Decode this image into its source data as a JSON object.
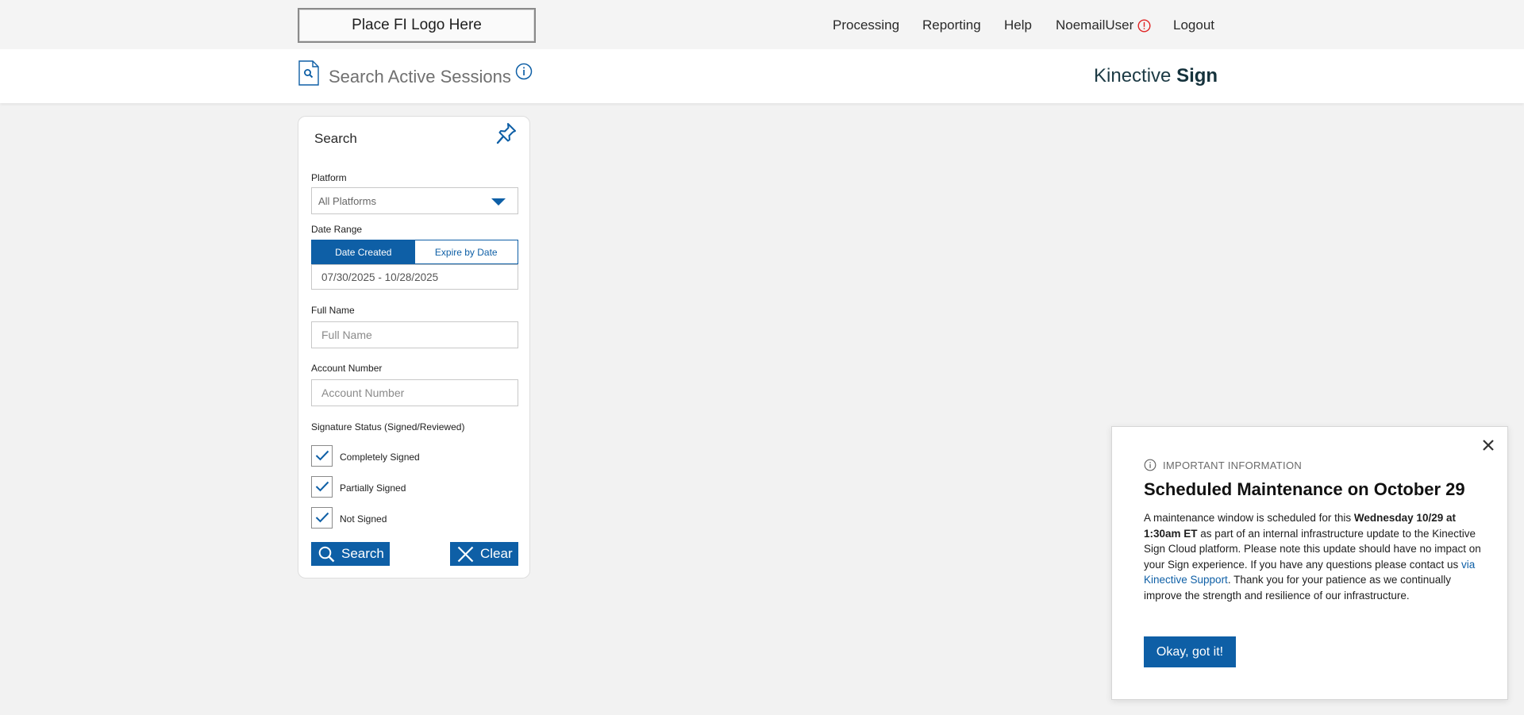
{
  "header": {
    "logo_text": "Place FI Logo Here",
    "nav": {
      "processing": "Processing",
      "reporting": "Reporting",
      "help": "Help",
      "user": "NoemailUser",
      "logout": "Logout"
    },
    "alert_icon": "alert-circle-icon",
    "alert_color": "#e02424"
  },
  "page": {
    "icon": "document-search-icon",
    "title": "Search Active Sessions",
    "info_icon": "info-circle-icon",
    "brand_light": "Kinective",
    "brand_bold": "Sign"
  },
  "search_panel": {
    "title": "Search",
    "pin_icon": "pin-icon",
    "platform": {
      "label": "Platform",
      "value": "All Platforms"
    },
    "date_range": {
      "label": "Date Range",
      "toggle_active": "Date Created",
      "toggle_inactive": "Expire by Date",
      "value": "07/30/2025 - 10/28/2025"
    },
    "full_name": {
      "label": "Full Name",
      "placeholder": "Full Name"
    },
    "account_number": {
      "label": "Account Number",
      "placeholder": "Account Number"
    },
    "signature_status": {
      "label": "Signature Status (Signed/Reviewed)",
      "options": [
        {
          "label": "Completely Signed",
          "checked": true
        },
        {
          "label": "Partially Signed",
          "checked": true
        },
        {
          "label": "Not Signed",
          "checked": true
        }
      ]
    },
    "search_button": "Search",
    "clear_button": "Clear"
  },
  "modal": {
    "eyebrow": "IMPORTANT INFORMATION",
    "title": "Scheduled Maintenance on October 29",
    "body_1": "A maintenance window is scheduled for this ",
    "body_bold": "Wednesday 10/29 at 1:30am ET",
    "body_2": " as part of an internal infrastructure update to the Kinective Sign Cloud platform. Please note this update should have no impact on your Sign experience. If you have any questions please contact us ",
    "body_link": "via Kinective Support",
    "body_3": ". Thank you for your patience as we continually improve the strength and resilience of our infrastructure.",
    "ok_button": "Okay, got it!"
  },
  "colors": {
    "accent": "#0e5fa6",
    "brand_text": "#1d3b45",
    "background": "#f2f2f2"
  }
}
